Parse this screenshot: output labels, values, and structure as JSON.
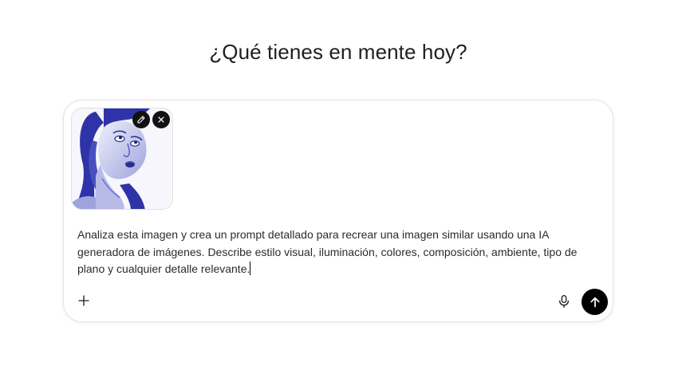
{
  "heading": "¿Qué tienes en mente hoy?",
  "composer": {
    "prompt_text": "Analiza esta imagen y crea un prompt detallado para recrear una imagen similar usando una IA generadora de imágenes. Describe estilo visual, iluminación, colores, composición, ambiente, tipo de plano y cualquier detalle relevante.",
    "attachment": {
      "type": "image",
      "icons": {
        "edit": "pencil-icon",
        "remove": "close-icon"
      }
    },
    "icons": {
      "attach": "plus-icon",
      "voice": "microphone-icon",
      "send": "arrow-up-icon"
    },
    "colors": {
      "send_button": "#000000",
      "attachment_tint": "#3b3fb0"
    }
  }
}
